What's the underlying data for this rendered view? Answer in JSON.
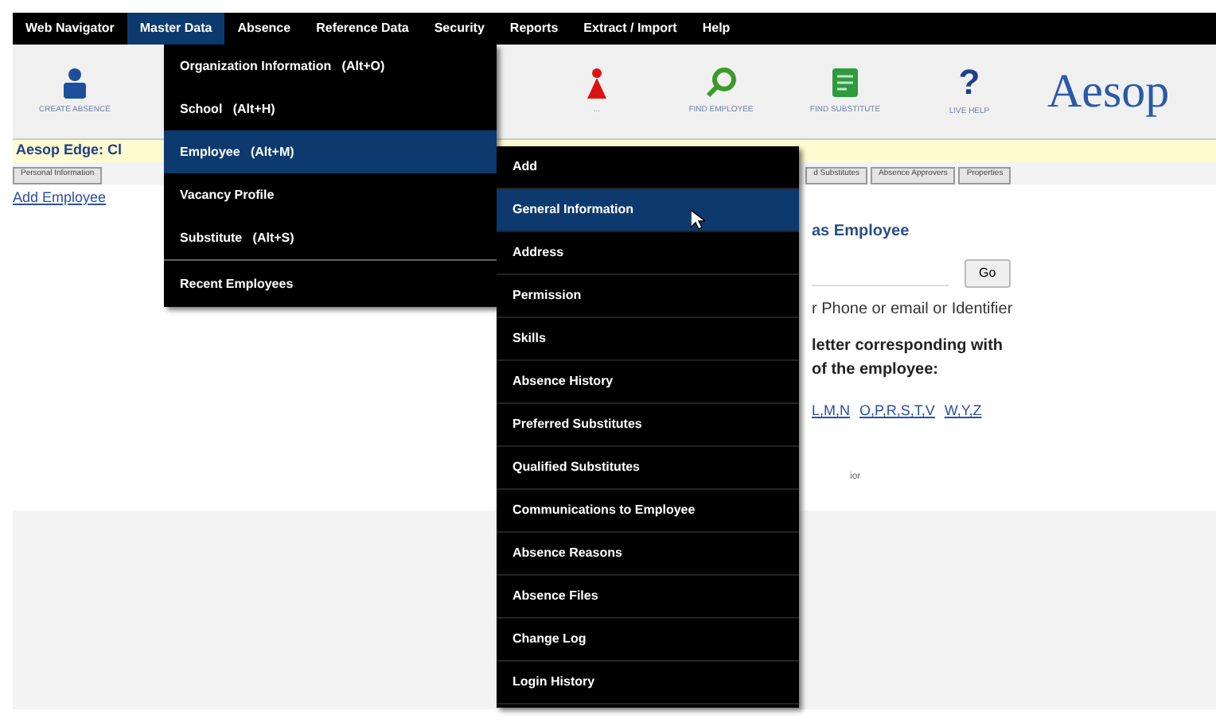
{
  "menubar": [
    {
      "label": "Web Navigator",
      "selected": false
    },
    {
      "label": "Master Data",
      "selected": true
    },
    {
      "label": "Absence",
      "selected": false
    },
    {
      "label": "Reference Data",
      "selected": false
    },
    {
      "label": "Security",
      "selected": false
    },
    {
      "label": "Reports",
      "selected": false
    },
    {
      "label": "Extract / Import",
      "selected": false
    },
    {
      "label": "Help",
      "selected": false
    }
  ],
  "toolbar": [
    {
      "kind": "person",
      "label": "CREATE ABSENCE"
    },
    {
      "kind": "alert",
      "label": "..."
    },
    {
      "kind": "search",
      "label": "FIND EMPLOYEE"
    },
    {
      "kind": "sheet",
      "label": "FIND SUBSTITUTE"
    },
    {
      "kind": "help",
      "glyph": "?",
      "label": "LIVE HELP"
    }
  ],
  "logo": "Aesop",
  "page_title": "Aesop Edge: Cl",
  "tabs": [
    {
      "label": "Personal Information",
      "selected": false
    },
    {
      "label": "d Substitutes",
      "selected": false
    },
    {
      "label": "Absence Approvers",
      "selected": false
    },
    {
      "label": "Properties",
      "selected": false
    }
  ],
  "add_link": "Add Employee",
  "heading": "as Employee",
  "search": {
    "button": "Go"
  },
  "hint": "r Phone or email or Identifier",
  "letter_hint": [
    "letter corresponding with",
    "of the employee:"
  ],
  "letter_links": [
    "L,M,N",
    "O,P,R,S,T,V",
    "W,Y,Z"
  ],
  "footer_fragment": "ior",
  "master_menu": [
    {
      "label": "Organization Information   (Alt+O)",
      "selected": false
    },
    {
      "label": "School   (Alt+H)",
      "selected": false
    },
    {
      "label": "Employee   (Alt+M)",
      "selected": true
    },
    {
      "label": "Vacancy Profile",
      "selected": false
    },
    {
      "label": "Substitute   (Alt+S)",
      "selected": false
    },
    {
      "label": "Recent Employees",
      "selected": false
    }
  ],
  "employee_submenu": [
    {
      "label": "Add",
      "selected": false
    },
    {
      "label": "General Information",
      "selected": true
    },
    {
      "label": "Address",
      "selected": false
    },
    {
      "label": "Permission",
      "selected": false
    },
    {
      "label": "Skills",
      "selected": false
    },
    {
      "label": "Absence History",
      "selected": false
    },
    {
      "label": "Preferred Substitutes",
      "selected": false
    },
    {
      "label": "Qualified Substitutes",
      "selected": false
    },
    {
      "label": "Communications to Employee",
      "selected": false
    },
    {
      "label": "Absence Reasons",
      "selected": false
    },
    {
      "label": "Absence Files",
      "selected": false
    },
    {
      "label": "Change Log",
      "selected": false
    },
    {
      "label": "Login History",
      "selected": false
    }
  ]
}
